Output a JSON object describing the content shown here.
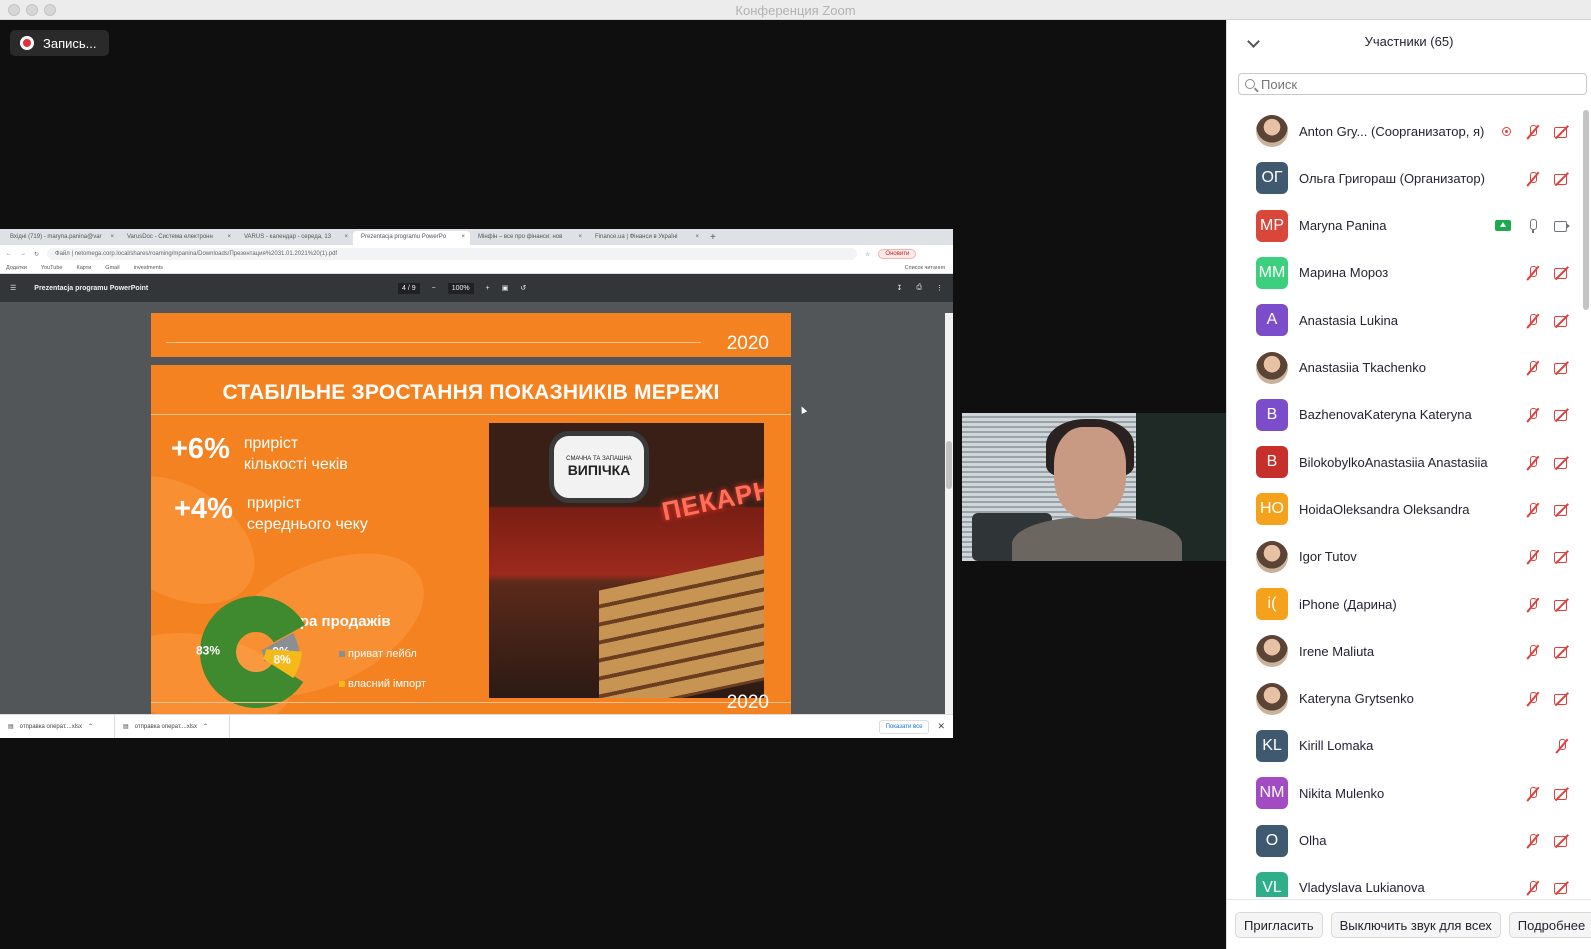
{
  "window": {
    "title": "Конференция Zoom"
  },
  "recording": {
    "label": "Запись..."
  },
  "browser": {
    "tabs": [
      {
        "label": "Вхідні (719) - maryna.panina@var",
        "active": false
      },
      {
        "label": "VarusDoc - Система електронн",
        "active": false
      },
      {
        "label": "VARUS - календар - середа, 13",
        "active": false
      },
      {
        "label": "Prezentacja programu PowerPo",
        "active": true
      },
      {
        "label": "Мінфін – все про фінанси: нов",
        "active": false
      },
      {
        "label": "Finance.ua | Фінанси в Україні",
        "active": false
      }
    ],
    "address": {
      "prefix": "Файл",
      "url": "netomega.corp.local/shares/roaming/mpanina/Downloads/Презентация%2031.01.2021%20(1).pdf",
      "update_label": "Оновити"
    },
    "bookmarks": [
      "Додатки",
      "YouTube",
      "Карти",
      "Gmail",
      "investments"
    ],
    "bookmarks_right": "Список читання",
    "pdf": {
      "title": "Prezentacja programu PowerPoint",
      "page": "4",
      "pages": "9",
      "zoom": "100%"
    },
    "downloads": [
      "отправка операт....xlsx",
      "отправка операт....xlsx"
    ],
    "show_all": "Показати все"
  },
  "slide_prev": {
    "year": "2020"
  },
  "slide": {
    "heading": "СТАБІЛЬНЕ ЗРОСТАННЯ ПОКАЗНИКІВ МЕРЕЖІ",
    "metric1": {
      "value": "+6%",
      "line1": "приріст",
      "line2": "кількості  чеків"
    },
    "metric2": {
      "value": "+4%",
      "line1": "приріст",
      "line2": "середнього чеку"
    },
    "structure_title": "Структура продажів",
    "legend": [
      {
        "label": "приват лейбл",
        "color": "#8a8f93"
      },
      {
        "label": "власний імпорт",
        "color": "#f6b91a"
      }
    ],
    "donut_labels": [
      "83%",
      "8%",
      "9%"
    ],
    "photo_badge_small": "СМАЧНА ТА ЗАПАШНА",
    "photo_badge_big": "ВИПІЧКА",
    "photo_neon": "ПЕКАРНЯ",
    "year": "2020"
  },
  "chart_data": {
    "type": "pie",
    "title": "Структура продажів",
    "categories": [
      "",
      "приват лейбл",
      "власний імпорт"
    ],
    "values": [
      83,
      9,
      8
    ],
    "colors": [
      "#3f8a2e",
      "#8a8f93",
      "#f6b91a"
    ]
  },
  "panel": {
    "title": "Участники (65)",
    "search_placeholder": "Поиск",
    "participants": [
      {
        "name": "Anton Gry...  (Соорганизатор, я)",
        "initials": "",
        "color": "",
        "photo": true,
        "rec": true,
        "share": false,
        "mic": "off",
        "cam": "off"
      },
      {
        "name": "Ольга Григораш (Организатор)",
        "initials": "ОГ",
        "color": "#3f5a70",
        "photo": false,
        "rec": false,
        "share": false,
        "mic": "off",
        "cam": "off"
      },
      {
        "name": "Maryna Panina",
        "initials": "MP",
        "color": "#d9463a",
        "photo": false,
        "rec": false,
        "share": true,
        "mic": "on",
        "cam": "on"
      },
      {
        "name": "Марина Мороз",
        "initials": "ММ",
        "color": "#3ccf7e",
        "photo": false,
        "rec": false,
        "share": false,
        "mic": "off",
        "cam": "off"
      },
      {
        "name": "Anastasia Lukina",
        "initials": "A",
        "color": "#7c4dcb",
        "photo": false,
        "rec": false,
        "share": false,
        "mic": "off",
        "cam": "off"
      },
      {
        "name": "Anastasiia Tkachenko",
        "initials": "",
        "color": "",
        "photo": true,
        "rec": false,
        "share": false,
        "mic": "off",
        "cam": "off"
      },
      {
        "name": "BazhenovaKateryna Kateryna",
        "initials": "B",
        "color": "#7c4dcb",
        "photo": false,
        "rec": false,
        "share": false,
        "mic": "off",
        "cam": "off"
      },
      {
        "name": "BilokobylkoAnastasiia Anastasiia",
        "initials": "B",
        "color": "#c7302a",
        "photo": false,
        "rec": false,
        "share": false,
        "mic": "off",
        "cam": "off"
      },
      {
        "name": "HoidaOleksandra Oleksandra",
        "initials": "HO",
        "color": "#f4a11c",
        "photo": false,
        "rec": false,
        "share": false,
        "mic": "off",
        "cam": "off"
      },
      {
        "name": "Igor Tutov",
        "initials": "",
        "color": "",
        "photo": true,
        "rec": false,
        "share": false,
        "mic": "off",
        "cam": "off"
      },
      {
        "name": "iPhone (Дарина)",
        "initials": "i(",
        "color": "#f4a11c",
        "photo": false,
        "rec": false,
        "share": false,
        "mic": "off",
        "cam": "off"
      },
      {
        "name": "Irene Maliuta",
        "initials": "",
        "color": "",
        "photo": true,
        "rec": false,
        "share": false,
        "mic": "off",
        "cam": "off"
      },
      {
        "name": "Kateryna Grytsenko",
        "initials": "",
        "color": "",
        "photo": true,
        "rec": false,
        "share": false,
        "mic": "off",
        "cam": "off"
      },
      {
        "name": "Kirill Lomaka",
        "initials": "KL",
        "color": "#3f5a70",
        "photo": false,
        "rec": false,
        "share": false,
        "mic": "off",
        "cam": "none"
      },
      {
        "name": "Nikita Mulenko",
        "initials": "NM",
        "color": "#a24bc2",
        "photo": false,
        "rec": false,
        "share": false,
        "mic": "off",
        "cam": "off"
      },
      {
        "name": "Olha",
        "initials": "O",
        "color": "#3f5a70",
        "photo": false,
        "rec": false,
        "share": false,
        "mic": "off",
        "cam": "off"
      },
      {
        "name": "Vladyslava Lukianova",
        "initials": "VL",
        "color": "#2fae8a",
        "photo": false,
        "rec": false,
        "share": false,
        "mic": "off",
        "cam": "off"
      }
    ],
    "footer": {
      "invite": "Пригласить",
      "mute_all": "Выключить звук для всех",
      "more": "Подробнее"
    }
  }
}
